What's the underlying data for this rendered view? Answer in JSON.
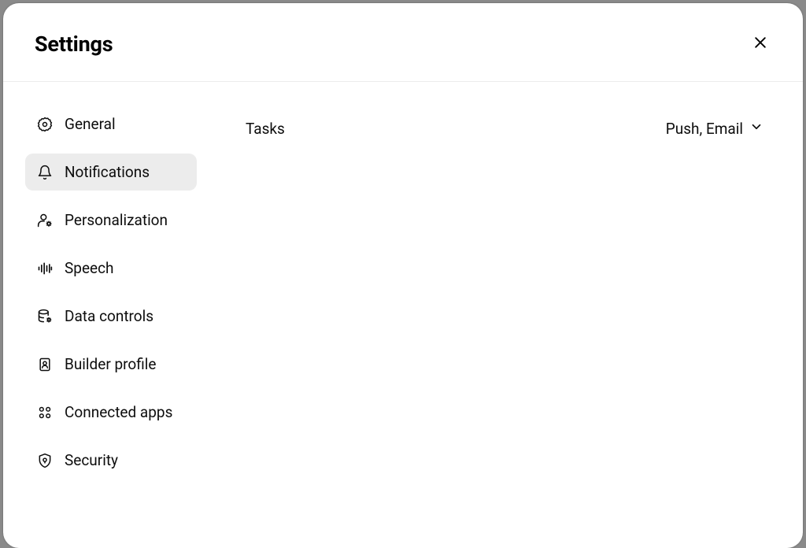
{
  "modal": {
    "title": "Settings"
  },
  "sidebar": {
    "items": [
      {
        "label": "General"
      },
      {
        "label": "Notifications"
      },
      {
        "label": "Personalization"
      },
      {
        "label": "Speech"
      },
      {
        "label": "Data controls"
      },
      {
        "label": "Builder profile"
      },
      {
        "label": "Connected apps"
      },
      {
        "label": "Security"
      }
    ]
  },
  "content": {
    "rows": [
      {
        "label": "Tasks",
        "value": "Push, Email"
      }
    ]
  }
}
